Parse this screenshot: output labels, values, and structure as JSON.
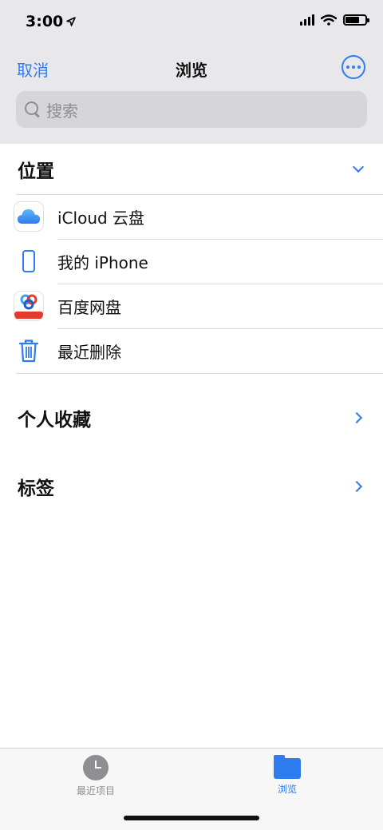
{
  "status_bar": {
    "time": "3:00",
    "location_icon": "location-arrow-icon",
    "signal_icon": "cellular-signal-icon",
    "wifi_icon": "wifi-icon",
    "battery_icon": "battery-icon"
  },
  "nav": {
    "cancel_label": "取消",
    "title": "浏览",
    "more_icon": "more-circle-icon"
  },
  "search": {
    "placeholder": "搜索",
    "icon": "search-icon"
  },
  "sections": {
    "locations": {
      "title": "位置",
      "state_icon": "chevron-down-icon",
      "items": [
        {
          "label": "iCloud 云盘",
          "icon": "icloud-drive-icon"
        },
        {
          "label": "我的 iPhone",
          "icon": "iphone-icon"
        },
        {
          "label": "百度网盘",
          "icon": "baidu-netdisk-icon"
        },
        {
          "label": "最近删除",
          "icon": "trash-icon"
        }
      ]
    },
    "favorites": {
      "title": "个人收藏",
      "state_icon": "chevron-right-icon"
    },
    "tags": {
      "title": "标签",
      "state_icon": "chevron-right-icon"
    }
  },
  "tab_bar": {
    "tabs": [
      {
        "label": "最近项目",
        "icon": "clock-icon",
        "selected": false
      },
      {
        "label": "浏览",
        "icon": "folder-icon",
        "selected": true
      }
    ]
  },
  "colors": {
    "accent": "#2f7bf0",
    "inactive": "#8e8e93",
    "header_bg": "#e8e8ea",
    "baidu_red": "#e23b2b"
  }
}
